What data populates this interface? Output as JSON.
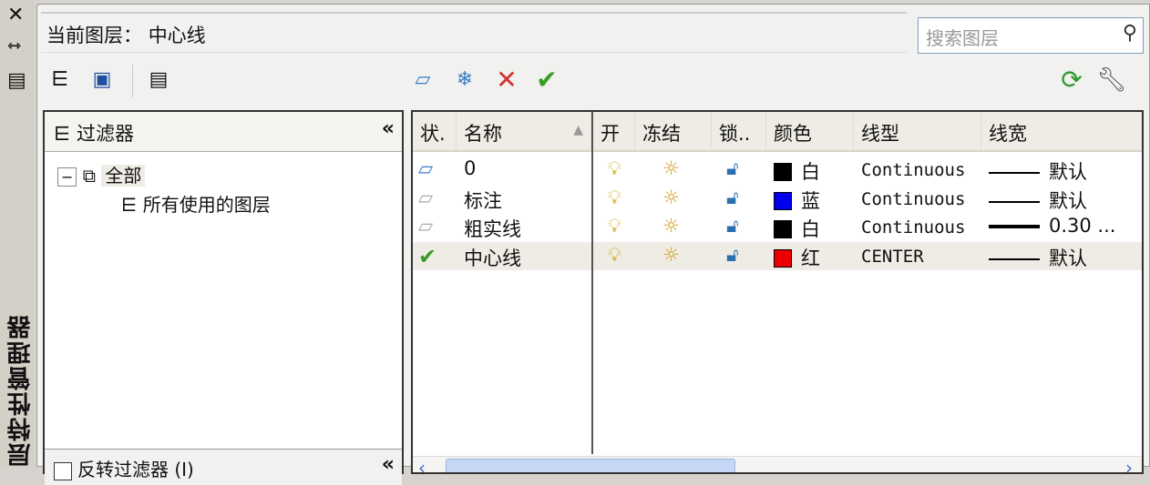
{
  "sidebar": {
    "title": "层特性管理器",
    "close": "✕",
    "autohide": "⇿",
    "props": "▤"
  },
  "header": {
    "current_layer_label": "当前图层：",
    "current_layer": "中心线"
  },
  "search": {
    "placeholder": "搜索图层"
  },
  "toolbar_left": [
    "new-property-filter",
    "new-group-filter",
    "layer-states-manager"
  ],
  "toolbar_mid": [
    "new-layer",
    "new-layer-vp-frozen",
    "delete-layer",
    "set-current"
  ],
  "toolbar_right": [
    "refresh",
    "settings"
  ],
  "filters": {
    "title": "过滤器",
    "tree": [
      {
        "label": "全部",
        "expanded": true
      },
      {
        "label": "所有使用的图层"
      }
    ],
    "invert_label": "反转过滤器 (I)"
  },
  "table": {
    "headers": [
      "状.",
      "名称",
      "开",
      "冻结",
      "锁..",
      "颜色",
      "线型",
      "线宽"
    ],
    "rows": [
      {
        "status": "layer",
        "name": "0",
        "color": "#000000",
        "color_name": "白",
        "linetype": "Continuous",
        "lineweight": "默认",
        "thick": false
      },
      {
        "status": "layer",
        "name": "标注",
        "color": "#0000ee",
        "color_name": "蓝",
        "linetype": "Continuous",
        "lineweight": "默认",
        "thick": false
      },
      {
        "status": "layer",
        "name": "粗实线",
        "color": "#000000",
        "color_name": "白",
        "linetype": "Continuous",
        "lineweight": "0.30 ...",
        "thick": true
      },
      {
        "status": "current",
        "name": "中心线",
        "color": "#ee0000",
        "color_name": "红",
        "linetype": "CENTER",
        "lineweight": "默认",
        "thick": false
      }
    ]
  }
}
